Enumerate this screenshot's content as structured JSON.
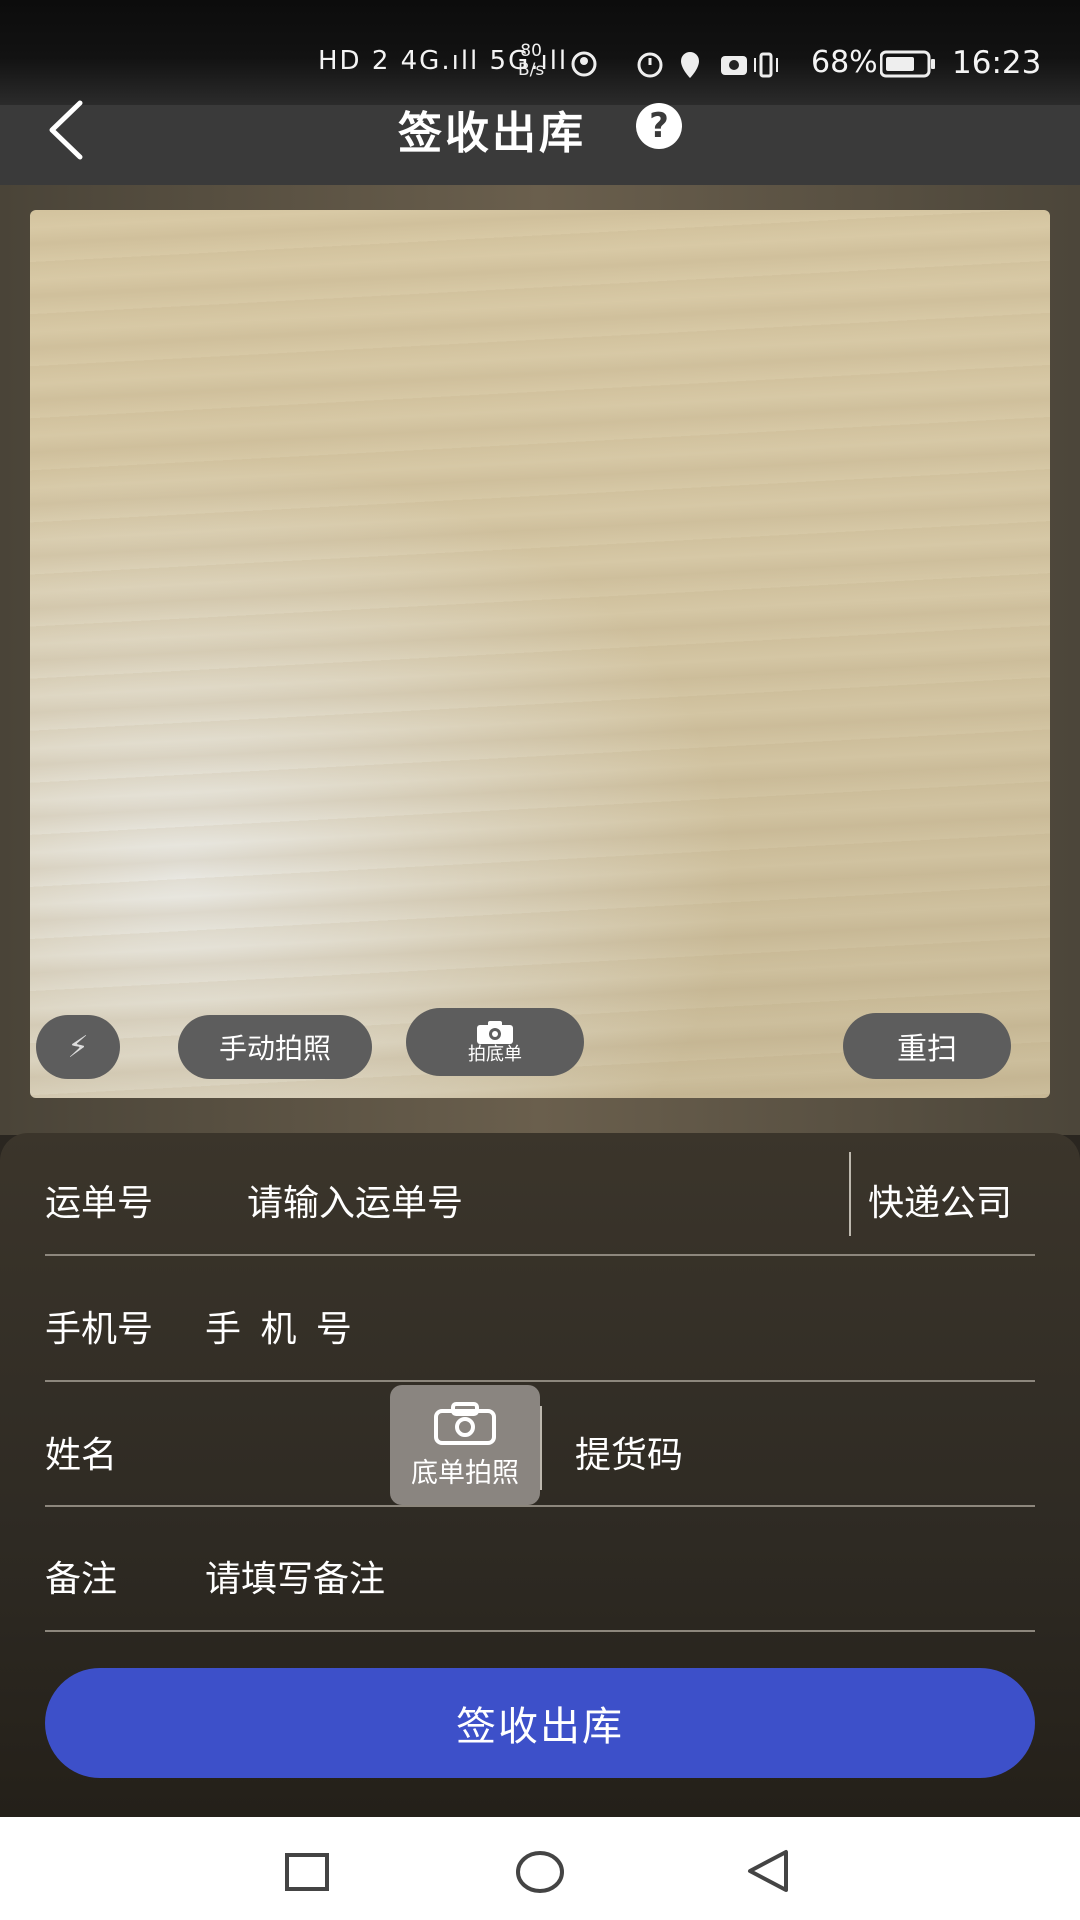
{
  "status_bar": {
    "left_indicators": "HD 2  4G.ıll  5G.ıll",
    "net_speed_top": "80",
    "net_speed_bottom": "B/s",
    "battery": "68%",
    "time": "16:23"
  },
  "header": {
    "title": "签收出库",
    "help_symbol": "?"
  },
  "camera": {
    "flash_glyph": "⚡",
    "manual_photo_label": "手动拍照",
    "receipt_photo_label": "拍底单",
    "rescan_label": "重扫"
  },
  "form": {
    "waybill_label": "运单号",
    "waybill_placeholder": "请输入运单号",
    "courier_label": "快递公司",
    "phone_label": "手机号",
    "phone_placeholder": "手 机 号",
    "name_label": "姓名",
    "receipt_photo_label": "底单拍照",
    "pickup_code_label": "提货码",
    "remark_label": "备注",
    "remark_placeholder": "请填写备注"
  },
  "submit": {
    "label": "签收出库"
  },
  "colors": {
    "accent": "#3d50c9",
    "panel": "#2e2a23"
  }
}
